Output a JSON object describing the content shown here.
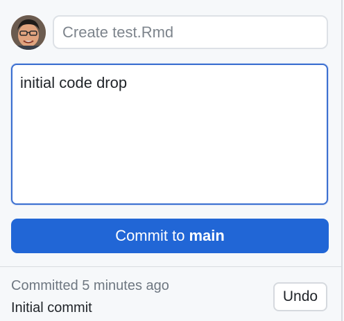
{
  "commit_form": {
    "summary_placeholder": "Create test.Rmd",
    "summary_value": "",
    "description_value": "initial code drop",
    "commit_button_prefix": "Commit to",
    "branch_name": "main",
    "accent_color": "#2166d6"
  },
  "last_commit": {
    "status_text": "Committed 5 minutes ago",
    "message": "Initial commit",
    "undo_label": "Undo"
  },
  "icons": {
    "avatar": "user-avatar"
  }
}
